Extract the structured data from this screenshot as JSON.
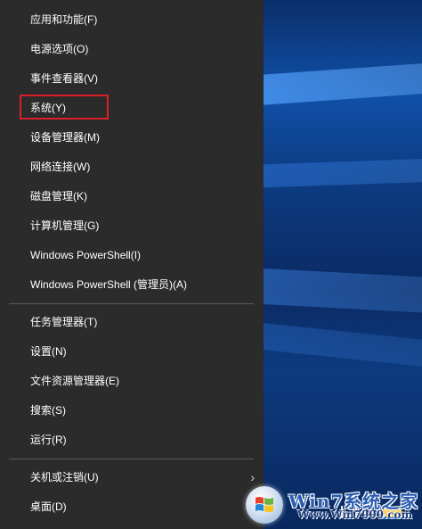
{
  "menu": {
    "items": [
      {
        "label": "应用和功能(F)"
      },
      {
        "label": "电源选项(O)"
      },
      {
        "label": "事件查看器(V)"
      },
      {
        "label": "系统(Y)",
        "highlighted": true
      },
      {
        "label": "设备管理器(M)"
      },
      {
        "label": "网络连接(W)"
      },
      {
        "label": "磁盘管理(K)"
      },
      {
        "label": "计算机管理(G)"
      },
      {
        "label": "Windows PowerShell(I)"
      },
      {
        "label": "Windows PowerShell (管理员)(A)"
      },
      {
        "label": "任务管理器(T)"
      },
      {
        "label": "设置(N)"
      },
      {
        "label": "文件资源管理器(E)"
      },
      {
        "label": "搜索(S)"
      },
      {
        "label": "运行(R)"
      },
      {
        "label": "关机或注销(U)",
        "has_submenu": true
      },
      {
        "label": "桌面(D)"
      }
    ],
    "submenu_arrow": "›"
  },
  "watermark": {
    "title": "Win7系统之家",
    "subtitle": "Www.Win7999.com"
  },
  "colors": {
    "menu_bg": "#2b2b2b",
    "highlight_border": "#d8202a",
    "desktop_blue": "#0a2a5e"
  },
  "icons": [
    "task-view-icon",
    "folder-icon",
    "chevron-right-icon",
    "windows-logo-icon"
  ]
}
